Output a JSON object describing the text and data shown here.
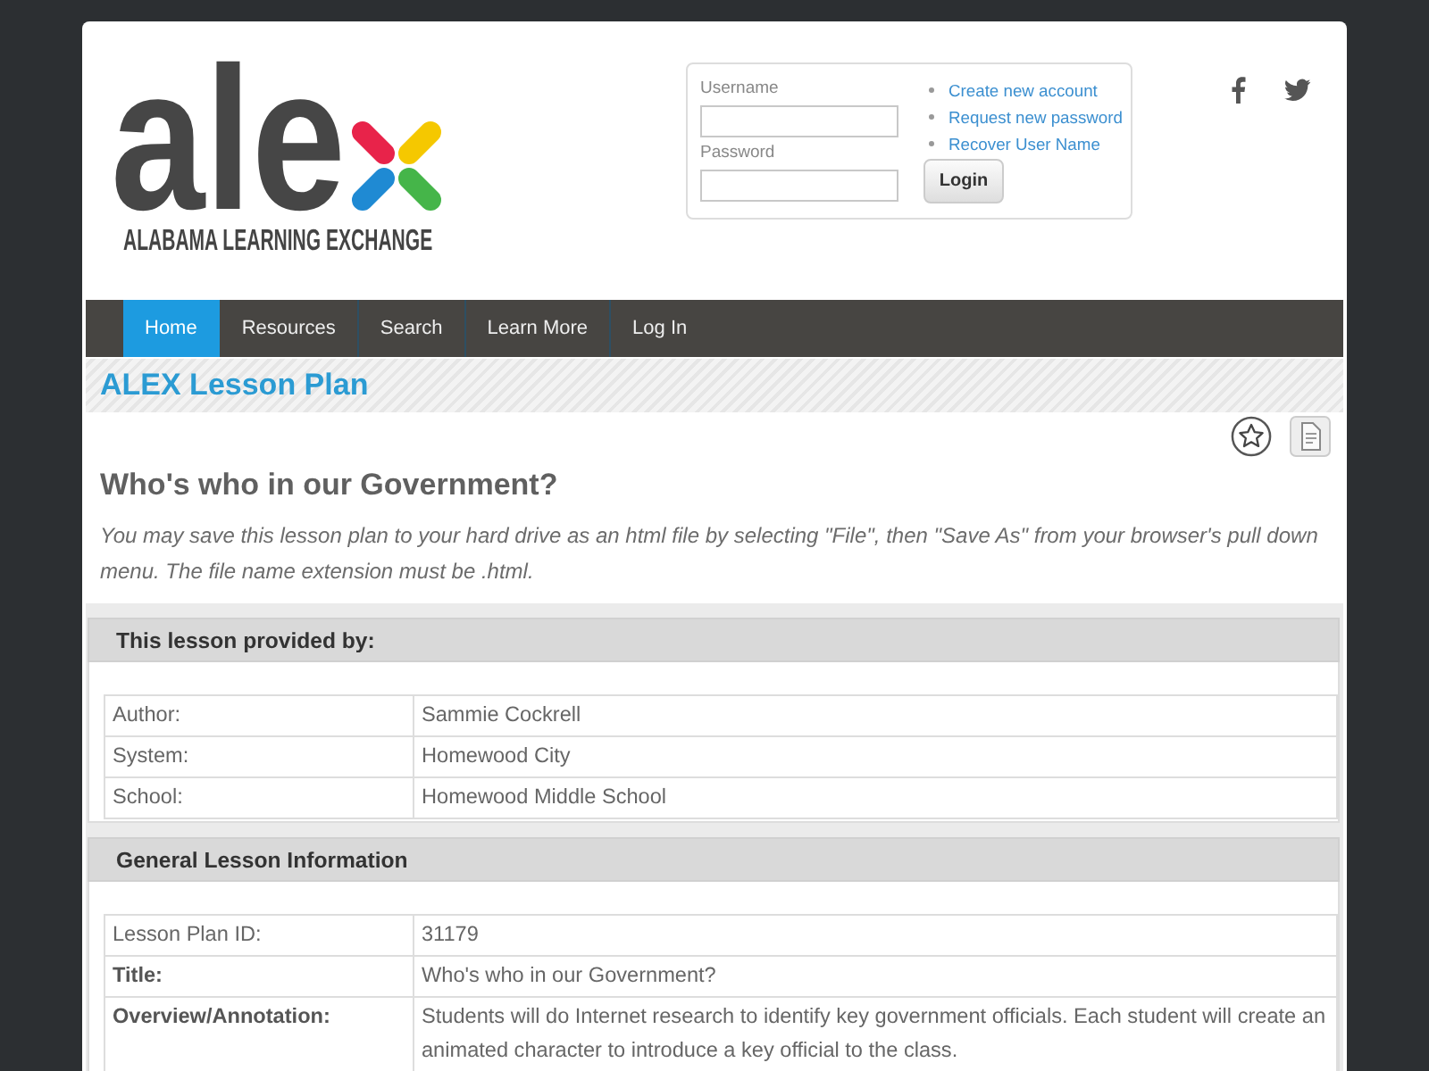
{
  "logo": {
    "wordmark": "ale",
    "tagline": "ALABAMA LEARNING EXCHANGE"
  },
  "login": {
    "fields": [
      {
        "label": "Username"
      },
      {
        "label": "Password"
      }
    ],
    "links": [
      "Create new account",
      "Request new password",
      "Recover User Name"
    ],
    "button": "Login"
  },
  "nav": [
    {
      "label": "Home",
      "selected": true
    },
    {
      "label": "Resources",
      "selected": false
    },
    {
      "label": "Search",
      "selected": false
    },
    {
      "label": "Learn More",
      "selected": false
    },
    {
      "label": "Log In",
      "selected": false
    }
  ],
  "page_title": "ALEX Lesson Plan",
  "lesson": {
    "title": "Who's who in our Government?",
    "note": "You may save this lesson plan to your hard drive as an html file by selecting \"File\", then \"Save As\" from your browser's pull down menu. The file name extension must be .html."
  },
  "sections": [
    {
      "heading": "This lesson provided by:",
      "rows": [
        {
          "label": "Author:",
          "value": "Sammie Cockrell",
          "bold": false
        },
        {
          "label": "System:",
          "value": "Homewood City",
          "bold": false
        },
        {
          "label": "School:",
          "value": "Homewood Middle School",
          "bold": false
        }
      ]
    },
    {
      "heading": "General Lesson Information",
      "rows": [
        {
          "label": "Lesson Plan ID:",
          "value": "31179",
          "bold": false
        },
        {
          "label": "Title:",
          "value": "Who's who in our Government?",
          "bold": true
        },
        {
          "label": "Overview/Annotation:",
          "value": "Students will do Internet research to identify key government officials. Each student will create an animated character to introduce a key official to the class.",
          "bold": true
        }
      ]
    }
  ]
}
